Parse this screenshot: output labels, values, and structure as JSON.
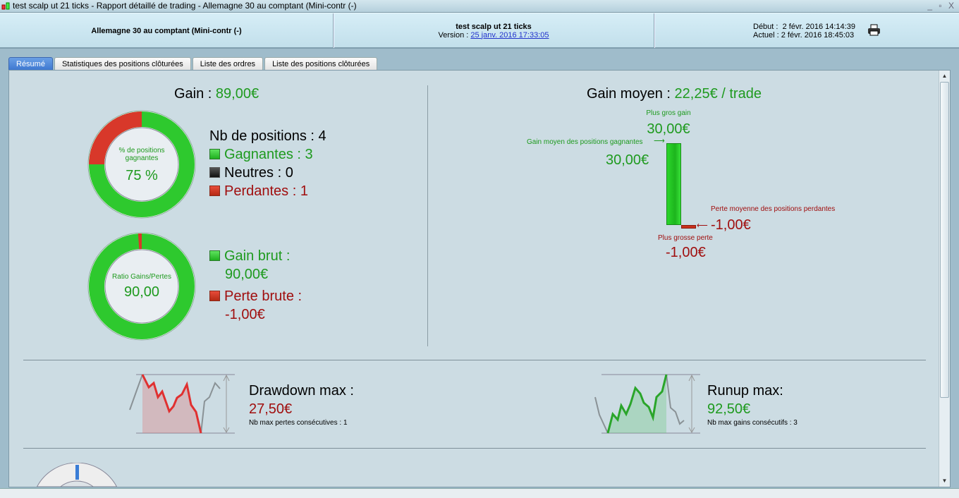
{
  "window": {
    "title": "test scalp ut 21 ticks - Rapport détaillé de trading - Allemagne 30 au comptant (Mini-contr (-)",
    "controls": "_ ▫ X"
  },
  "header": {
    "instrument": "Allemagne 30 au comptant (Mini-contr (-)",
    "system_name": "test scalp ut 21 ticks",
    "version_label": "Version :",
    "version_value": "25 janv. 2016 17:33:05",
    "start_label": "Début :",
    "start_value": "2 févr. 2016 14:14:39",
    "current_label": "Actuel :",
    "current_value": "2 févr. 2016 18:45:03"
  },
  "tabs": [
    {
      "label": "Résumé",
      "active": true
    },
    {
      "label": "Statistiques des positions clôturées"
    },
    {
      "label": "Liste des ordres"
    },
    {
      "label": "Liste des positions clôturées"
    }
  ],
  "summary": {
    "gain_label": "Gain :",
    "gain_value": "89,00€",
    "win_donut": {
      "caption": "% de positions gagnantes",
      "value": "75 %",
      "win_fraction": 0.75
    },
    "positions_label": "Nb de positions : 4",
    "winners": "Gagnantes : 3",
    "neutral": "Neutres : 0",
    "losers": "Perdantes : 1",
    "ratio_donut": {
      "caption": "Ratio Gains/Pertes",
      "value": "90,00",
      "loss_fraction": 0.011
    },
    "gross_gain_label": "Gain brut :",
    "gross_gain_value": "90,00€",
    "gross_loss_label": "Perte brute :",
    "gross_loss_value": "-1,00€",
    "avg_label": "Gain moyen :",
    "avg_value": "22,25€ / trade",
    "biggest_gain_label": "Plus gros gain",
    "biggest_gain_value": "30,00€",
    "avg_win_label": "Gain moyen des positions gagnantes",
    "avg_win_value": "30,00€",
    "avg_loss_label": "Perte moyenne des positions perdantes",
    "avg_loss_value": "-1,00€",
    "biggest_loss_label": "Plus grosse perte",
    "biggest_loss_value": "-1,00€",
    "drawdown_label": "Drawdown max :",
    "drawdown_value": "27,50€",
    "max_consec_losses": "Nb max pertes consécutives : 1",
    "runup_label": "Runup max:",
    "runup_value": "92,50€",
    "max_consec_wins": "Nb max gains consécutifs : 3"
  },
  "colors": {
    "green": "#1e9a1e",
    "red": "#a00e0e",
    "bg": "#ccdce3"
  }
}
